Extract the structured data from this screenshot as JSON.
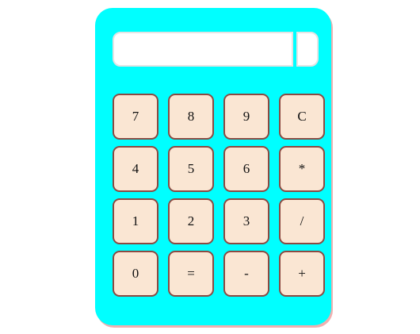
{
  "display": {
    "value": ""
  },
  "colors": {
    "body": "#00ffff",
    "key_fill": "#fae6d3",
    "key_border": "#8b4a42",
    "display_bg": "#ffffff"
  },
  "keys": [
    {
      "label": "7"
    },
    {
      "label": "8"
    },
    {
      "label": "9"
    },
    {
      "label": "C"
    },
    {
      "label": "4"
    },
    {
      "label": "5"
    },
    {
      "label": "6"
    },
    {
      "label": "*"
    },
    {
      "label": "1"
    },
    {
      "label": "2"
    },
    {
      "label": "3"
    },
    {
      "label": "/"
    },
    {
      "label": "0"
    },
    {
      "label": "="
    },
    {
      "label": "-"
    },
    {
      "label": "+"
    }
  ]
}
